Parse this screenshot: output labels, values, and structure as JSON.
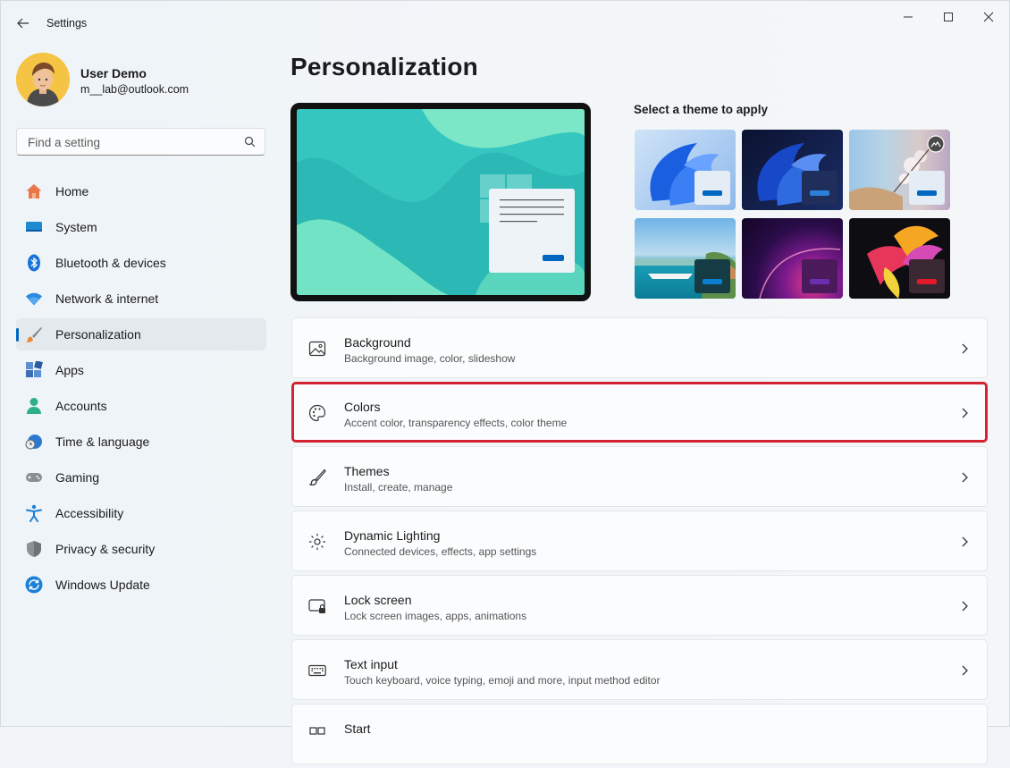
{
  "window": {
    "title": "Settings"
  },
  "user": {
    "name": "User Demo",
    "email": "m__lab@outlook.com"
  },
  "search": {
    "placeholder": "Find a setting",
    "value": ""
  },
  "sidebar": {
    "items": [
      {
        "label": "Home",
        "icon": "home-icon"
      },
      {
        "label": "System",
        "icon": "system-icon"
      },
      {
        "label": "Bluetooth & devices",
        "icon": "bluetooth-icon"
      },
      {
        "label": "Network & internet",
        "icon": "wifi-icon"
      },
      {
        "label": "Personalization",
        "icon": "brush-icon",
        "selected": true
      },
      {
        "label": "Apps",
        "icon": "apps-icon"
      },
      {
        "label": "Accounts",
        "icon": "accounts-icon"
      },
      {
        "label": "Time & language",
        "icon": "clock-globe-icon"
      },
      {
        "label": "Gaming",
        "icon": "gamepad-icon"
      },
      {
        "label": "Accessibility",
        "icon": "accessibility-icon"
      },
      {
        "label": "Privacy & security",
        "icon": "shield-icon"
      },
      {
        "label": "Windows Update",
        "icon": "update-icon"
      }
    ]
  },
  "main": {
    "title": "Personalization",
    "theme_label": "Select a theme to apply",
    "settings": [
      {
        "title": "Background",
        "subtitle": "Background image, color, slideshow",
        "icon": "image-icon"
      },
      {
        "title": "Colors",
        "subtitle": "Accent color, transparency effects, color theme",
        "icon": "palette-icon",
        "highlighted": true
      },
      {
        "title": "Themes",
        "subtitle": "Install, create, manage",
        "icon": "brush-icon"
      },
      {
        "title": "Dynamic Lighting",
        "subtitle": "Connected devices, effects, app settings",
        "icon": "lighting-icon"
      },
      {
        "title": "Lock screen",
        "subtitle": "Lock screen images, apps, animations",
        "icon": "lock-screen-icon"
      },
      {
        "title": "Text input",
        "subtitle": "Touch keyboard, voice typing, emoji and more, input method editor",
        "icon": "keyboard-icon"
      },
      {
        "title": "Start",
        "subtitle": "",
        "icon": "start-icon"
      }
    ]
  },
  "colors": {
    "accent": "#0067c0",
    "highlight": "#d32232"
  }
}
